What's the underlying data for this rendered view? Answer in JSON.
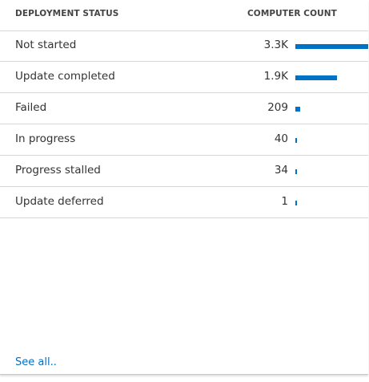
{
  "table": {
    "headers": {
      "status": "DEPLOYMENT STATUS",
      "count": "COMPUTER COUNT"
    },
    "rows": [
      {
        "label": "Not started",
        "count_text": "3.3K",
        "value": 3300
      },
      {
        "label": "Update completed",
        "count_text": "1.9K",
        "value": 1900
      },
      {
        "label": "Failed",
        "count_text": "209",
        "value": 209
      },
      {
        "label": "In progress",
        "count_text": "40",
        "value": 40
      },
      {
        "label": "Progress stalled",
        "count_text": "34",
        "value": 34
      },
      {
        "label": "Update deferred",
        "count_text": "1",
        "value": 1
      }
    ],
    "bar_color": "#0072c6"
  },
  "footer": {
    "see_all_label": "See all.."
  }
}
